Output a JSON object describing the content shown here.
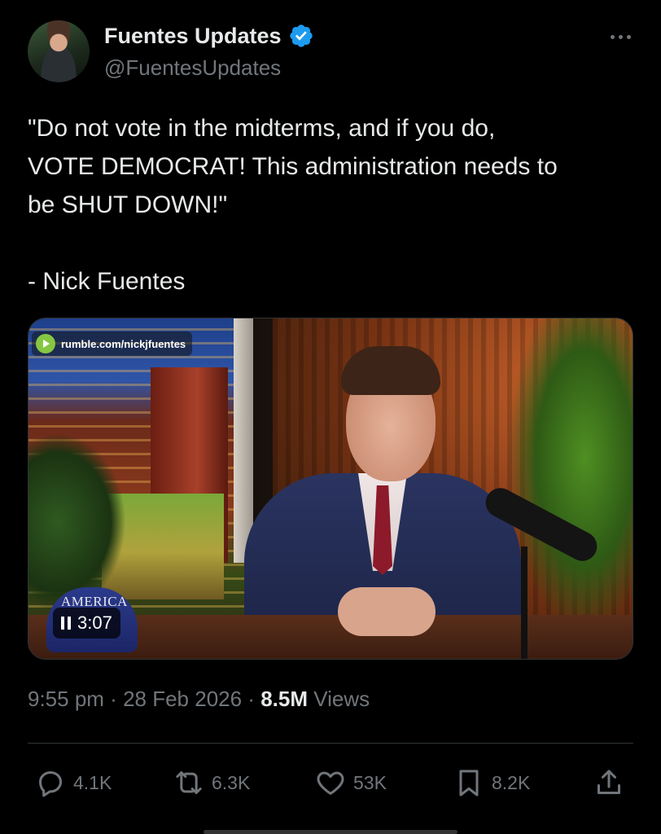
{
  "author": {
    "name": "Fuentes Updates",
    "handle": "@FuentesUpdates",
    "verified": true,
    "verified_color": "#1d9bf0"
  },
  "tweet": {
    "lines": [
      "\"Do not vote in the midterms, and if you do,",
      "VOTE DEMOCRAT! This administration needs to",
      "be SHUT DOWN!\""
    ],
    "attribution": "- Nick Fuentes"
  },
  "video": {
    "source": "rumble.com/nickjfuentes",
    "source_logo_color": "#85c742",
    "hat_text": "AMERICA",
    "elapsed": "3:07",
    "state": "playing"
  },
  "meta": {
    "time": "9:55 pm",
    "separator": " · ",
    "date": "28 Feb 2026",
    "views_count": "8.5M",
    "views_label": "Views"
  },
  "actions": {
    "replies": "4.1K",
    "reposts": "6.3K",
    "likes": "53K",
    "bookmarks": "8.2K"
  },
  "colors": {
    "background": "#000000",
    "text_primary": "#e7e9ea",
    "text_secondary": "#71767b",
    "divider": "#2f3336"
  }
}
